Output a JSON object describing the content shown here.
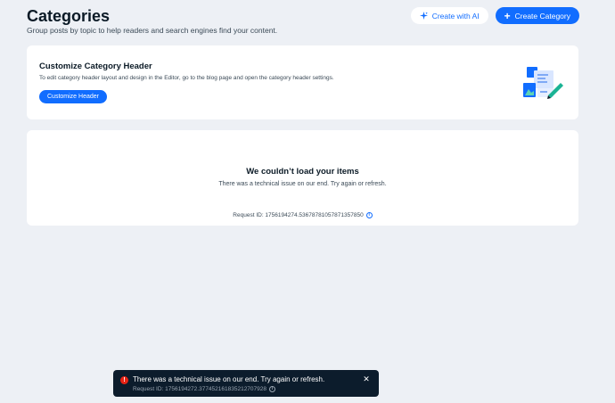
{
  "header": {
    "title": "Categories",
    "subtitle": "Group posts by topic to help readers and search engines find your content.",
    "ai_button_label": "Create with AI",
    "create_button_label": "Create Category"
  },
  "customize_card": {
    "title": "Customize Category Header",
    "description": "To edit category header layout and design in the Editor, go to the blog page and open the category header settings.",
    "button_label": "Customize Header"
  },
  "error_card": {
    "title": "We couldn’t load your items",
    "description": "There was a technical issue on our end. Try again or refresh.",
    "request_id": "Request ID: 1756194274.5367878105787​1357850"
  },
  "toast": {
    "message": "There was a technical issue on our end. Try again or refresh.",
    "request_id": "Request ID: 1756194272.3774521618352127​07928"
  },
  "colors": {
    "accent": "#116dff",
    "background": "#edf0f5",
    "error": "#e62214",
    "toast_bg": "#0c1c2c"
  },
  "icons": {
    "ai": "sparkle-icon",
    "create": "plus-icon",
    "info": "info-icon",
    "toast_status": "error-icon",
    "toast_close": "close-icon"
  }
}
